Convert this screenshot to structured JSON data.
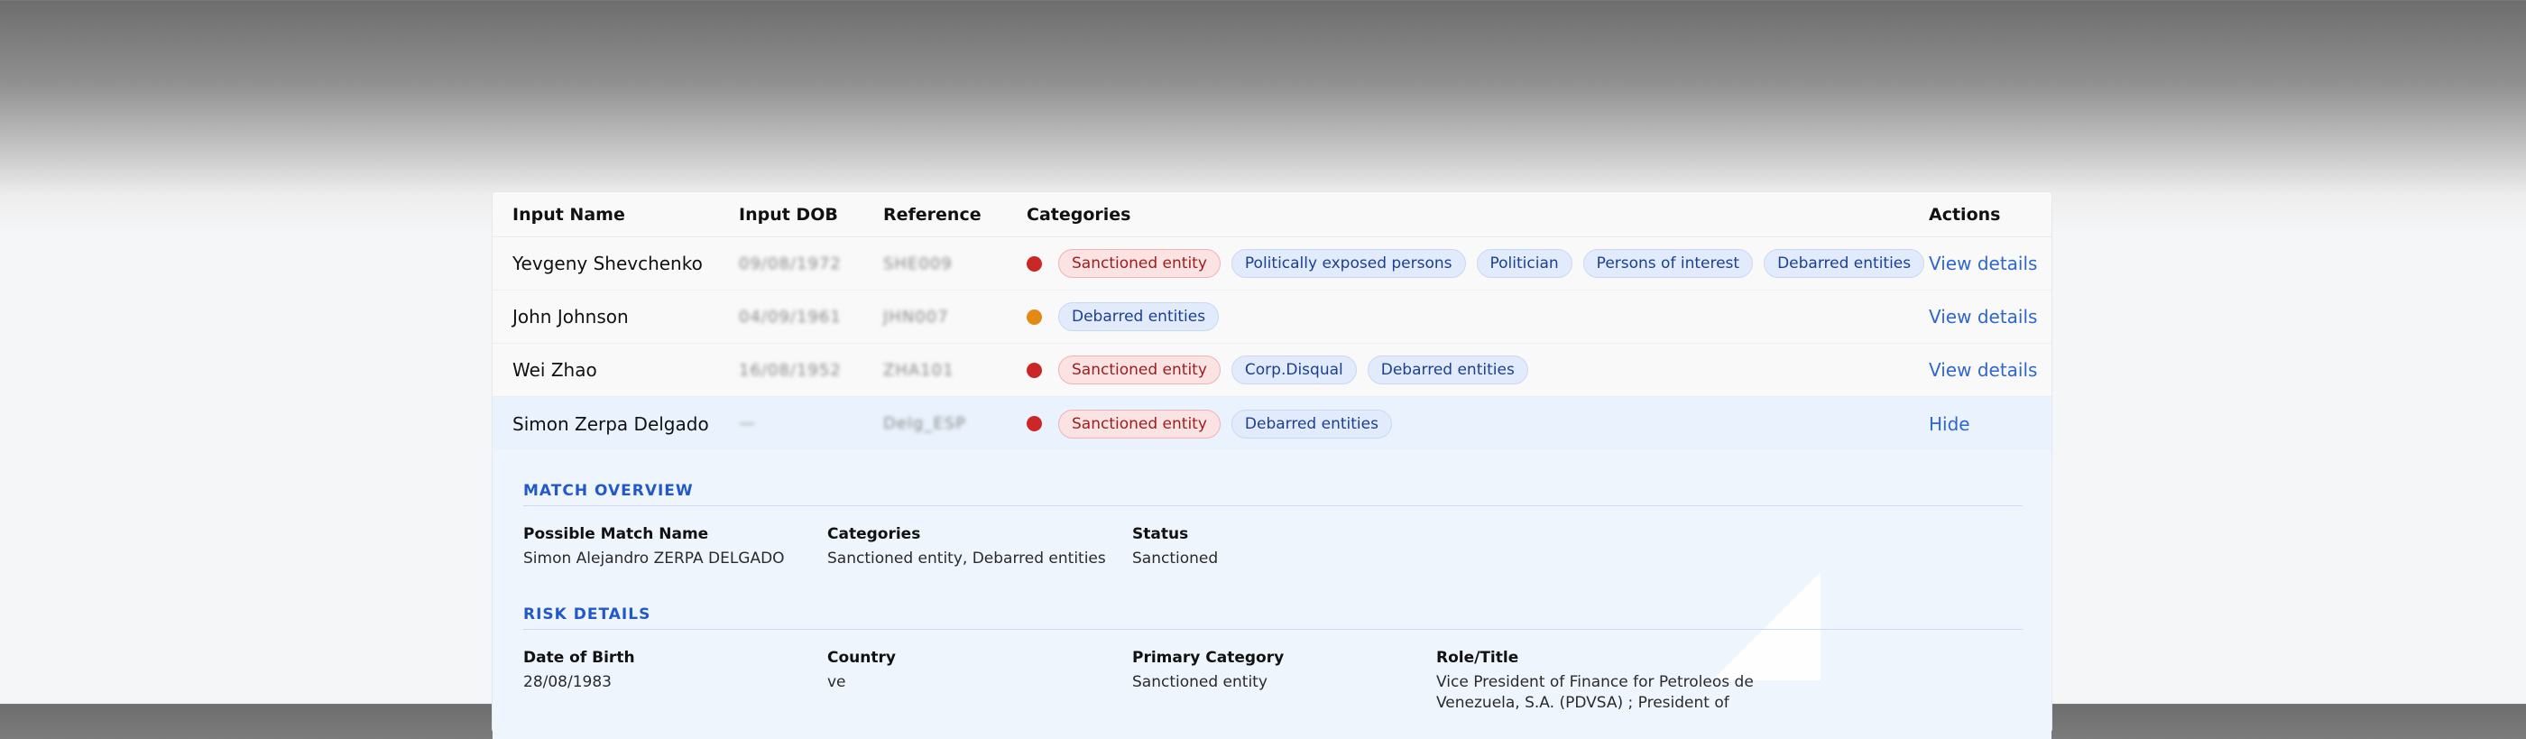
{
  "table": {
    "headers": {
      "input_name": "Input Name",
      "input_dob": "Input DOB",
      "reference": "Reference",
      "categories": "Categories",
      "actions": "Actions"
    },
    "rows": [
      {
        "name": "Yevgeny Shevchenko",
        "dob": "09/08/1972",
        "reference": "SHE009",
        "status_color": "#cc2727",
        "tags": [
          "Sanctioned entity",
          "Politically exposed persons",
          "Politician",
          "Persons of interest",
          "Debarred entities"
        ],
        "action": "View details"
      },
      {
        "name": "John Johnson",
        "dob": "04/09/1961",
        "reference": "JHN007",
        "status_color": "#e38a12",
        "tags": [
          "Debarred entities"
        ],
        "action": "View details"
      },
      {
        "name": "Wei Zhao",
        "dob": "16/08/1952",
        "reference": "ZHA101",
        "status_color": "#cc2727",
        "tags": [
          "Sanctioned entity",
          "Corp.Disqual",
          "Debarred entities"
        ],
        "action": "View details"
      },
      {
        "name": "Simon Zerpa Delgado",
        "dob": "—",
        "reference": "Delg_ESP",
        "status_color": "#cc2727",
        "tags": [
          "Sanctioned entity",
          "Debarred entities"
        ],
        "action": "Hide"
      }
    ]
  },
  "details": {
    "match_overview": {
      "title": "MATCH OVERVIEW",
      "possible_match_label": "Possible Match Name",
      "possible_match_value": "Simon Alejandro ZERPA DELGADO",
      "categories_label": "Categories",
      "categories_value": "Sanctioned entity, Debarred entities",
      "status_label": "Status",
      "status_value": "Sanctioned"
    },
    "risk_details": {
      "title": "RISK DETAILS",
      "dob_label": "Date of Birth",
      "dob_value": "28/08/1983",
      "country_label": "Country",
      "country_value": "ve",
      "primary_category_label": "Primary Category",
      "primary_category_value": "Sanctioned entity",
      "role_label": "Role/Title",
      "role_line1": "Vice President of Finance for Petroleos de",
      "role_line2": "Venezuela, S.A. (PDVSA) ; President of"
    }
  }
}
